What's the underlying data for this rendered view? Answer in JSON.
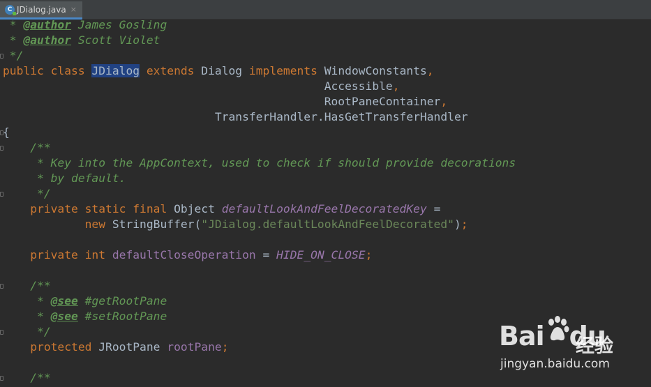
{
  "tab": {
    "icon_letter": "C",
    "filename": "JDialog.java",
    "close": "×"
  },
  "code": [
    {
      "tokens": [
        {
          "t": " * ",
          "c": "doc"
        },
        {
          "t": "@author",
          "c": "doctag"
        },
        {
          "t": " James Gosling",
          "c": "doc"
        }
      ]
    },
    {
      "tokens": [
        {
          "t": " * ",
          "c": "doc"
        },
        {
          "t": "@author",
          "c": "doctag"
        },
        {
          "t": " Scott Violet",
          "c": "doc"
        }
      ]
    },
    {
      "tokens": [
        {
          "t": " */",
          "c": "doc"
        }
      ],
      "fold": true
    },
    {
      "tokens": [
        {
          "t": "public class ",
          "c": "kw"
        },
        {
          "t": "JDialog",
          "c": "plain hl"
        },
        {
          "t": " extends ",
          "c": "kw"
        },
        {
          "t": "Dialog ",
          "c": "plain"
        },
        {
          "t": "implements ",
          "c": "kw"
        },
        {
          "t": "WindowConstants",
          "c": "plain"
        },
        {
          "t": ",",
          "c": "kw"
        }
      ]
    },
    {
      "tokens": [
        {
          "t": "                                               Accessible",
          "c": "plain"
        },
        {
          "t": ",",
          "c": "kw"
        }
      ]
    },
    {
      "tokens": [
        {
          "t": "                                               RootPaneContainer",
          "c": "plain"
        },
        {
          "t": ",",
          "c": "kw"
        }
      ]
    },
    {
      "tokens": [
        {
          "t": "                               TransferHandler.HasGetTransferHandler",
          "c": "plain"
        }
      ]
    },
    {
      "tokens": [
        {
          "t": "{",
          "c": "plain"
        }
      ],
      "fold": true
    },
    {
      "tokens": [
        {
          "t": "    /**",
          "c": "doc"
        }
      ],
      "fold": true
    },
    {
      "tokens": [
        {
          "t": "     * Key into the AppContext, used to check if should provide decorations",
          "c": "doc"
        }
      ]
    },
    {
      "tokens": [
        {
          "t": "     * by default.",
          "c": "doc"
        }
      ]
    },
    {
      "tokens": [
        {
          "t": "     */",
          "c": "doc"
        }
      ],
      "fold": true
    },
    {
      "tokens": [
        {
          "t": "    private static final ",
          "c": "kw"
        },
        {
          "t": "Object ",
          "c": "plain"
        },
        {
          "t": "defaultLookAndFeelDecoratedKey",
          "c": "sfield"
        },
        {
          "t": " =",
          "c": "plain"
        }
      ]
    },
    {
      "tokens": [
        {
          "t": "            new ",
          "c": "kw"
        },
        {
          "t": "StringBuffer(",
          "c": "plain"
        },
        {
          "t": "\"JDialog.defaultLookAndFeelDecorated\"",
          "c": "str"
        },
        {
          "t": ")",
          "c": "plain"
        },
        {
          "t": ";",
          "c": "kw"
        }
      ]
    },
    {
      "tokens": []
    },
    {
      "tokens": [
        {
          "t": "    private int ",
          "c": "kw"
        },
        {
          "t": "defaultCloseOperation",
          "c": "field"
        },
        {
          "t": " = ",
          "c": "plain"
        },
        {
          "t": "HIDE_ON_CLOSE",
          "c": "sfield"
        },
        {
          "t": ";",
          "c": "kw"
        }
      ]
    },
    {
      "tokens": []
    },
    {
      "tokens": [
        {
          "t": "    /**",
          "c": "doc"
        }
      ],
      "fold": true
    },
    {
      "tokens": [
        {
          "t": "     * ",
          "c": "doc"
        },
        {
          "t": "@see",
          "c": "doctag"
        },
        {
          "t": " #getRootPane",
          "c": "doc"
        }
      ]
    },
    {
      "tokens": [
        {
          "t": "     * ",
          "c": "doc"
        },
        {
          "t": "@see",
          "c": "doctag"
        },
        {
          "t": " #setRootPane",
          "c": "doc"
        }
      ]
    },
    {
      "tokens": [
        {
          "t": "     */",
          "c": "doc"
        }
      ],
      "fold": true
    },
    {
      "tokens": [
        {
          "t": "    protected ",
          "c": "kw"
        },
        {
          "t": "JRootPane ",
          "c": "plain"
        },
        {
          "t": "rootPane",
          "c": "field"
        },
        {
          "t": ";",
          "c": "kw"
        }
      ]
    },
    {
      "tokens": []
    },
    {
      "tokens": [
        {
          "t": "    /**",
          "c": "doc"
        }
      ],
      "fold": true
    }
  ],
  "watermark": {
    "brand_left": "Bai",
    "brand_right": "du",
    "chinese": "经验",
    "url": "jingyan.baidu.com"
  },
  "colors": {
    "background": "#2b2b2b",
    "keyword": "#cc7832",
    "doc_comment": "#629755",
    "field": "#9876aa",
    "string": "#6a8759",
    "text": "#a9b7c6",
    "selection": "#214283"
  }
}
